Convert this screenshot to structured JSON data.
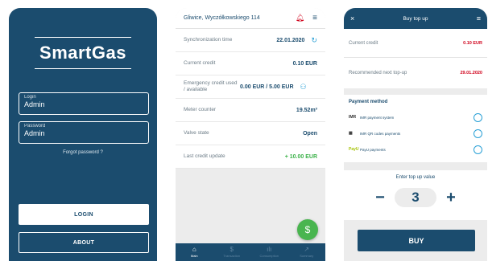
{
  "login_screen": {
    "logo": "SmartGas",
    "login_label": "Login",
    "login_value": "Admin",
    "password_label": "Password",
    "password_value": "Admin",
    "forgot": "Forgot password ?",
    "login_button": "LOGIN",
    "about_button": "ABOUT"
  },
  "main_screen": {
    "address": "Gliwice, Wyczółkowskiego 114",
    "bell_icon": "bell-icon",
    "menu_icon": "hamburger-menu-icon",
    "rows": [
      {
        "label": "Synchronization time",
        "value": "22.01.2020",
        "icon": "↻"
      },
      {
        "label": "Current credit",
        "value": "0.10 EUR",
        "icon": ""
      },
      {
        "label": "Emergency credit used / available",
        "value": "0.00 EUR / 5.00 EUR",
        "icon": "⚇"
      },
      {
        "label": "Meter counter",
        "value": "19.52m³",
        "icon": ""
      },
      {
        "label": "Valve state",
        "value": "Open",
        "icon": ""
      },
      {
        "label": "Last credit update",
        "value": "+ 10.00 EUR",
        "icon": ""
      }
    ],
    "fab_symbol": "$",
    "nav": [
      {
        "label": "Main",
        "glyph": "⌂"
      },
      {
        "label": "Transaction",
        "glyph": "$"
      },
      {
        "label": "Consumption",
        "glyph": "ılı"
      },
      {
        "label": "Summary",
        "glyph": "↗"
      }
    ],
    "colors": {
      "primary": "#1b4c6e",
      "accent_green": "#3cb24a",
      "alert_red": "#d0021b"
    }
  },
  "topup_screen": {
    "close": "×",
    "title": "Buy top up",
    "menu": "≡",
    "current_credit_label": "Current credit",
    "current_credit_value": "0.10 EUR",
    "recommended_label": "Recommended next top-up",
    "recommended_value": "29.01.2020",
    "payment_header": "Payment method",
    "payment_options": [
      {
        "label": "IMR payment system",
        "icon": "IMR"
      },
      {
        "label": "IMR QR codes payments",
        "icon": "▦"
      },
      {
        "label": "PayU payments",
        "icon": "PayU"
      }
    ],
    "enter_header": "Enter top up value",
    "minus": "−",
    "value": "3",
    "plus": "+",
    "buy_button": "BUY"
  }
}
